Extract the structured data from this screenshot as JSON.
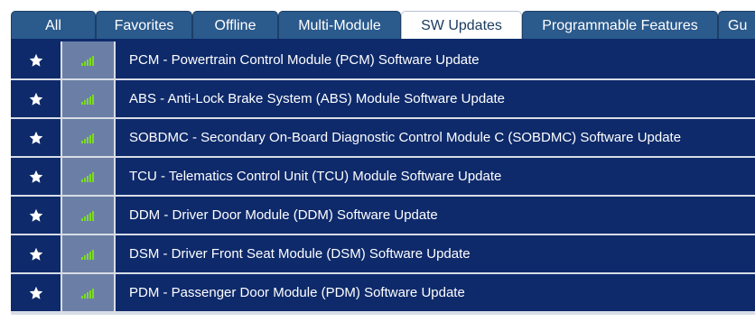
{
  "tabs": [
    {
      "label": "All",
      "active": false
    },
    {
      "label": "Favorites",
      "active": false
    },
    {
      "label": "Offline",
      "active": false
    },
    {
      "label": "Multi-Module",
      "active": false
    },
    {
      "label": "SW Updates",
      "active": true
    },
    {
      "label": "Programmable Features",
      "active": false
    },
    {
      "label": "Gu",
      "active": false
    }
  ],
  "rows": [
    {
      "label": "PCM - Powertrain Control Module (PCM) Software Update",
      "favorite_icon": "star-icon",
      "status_icon": "signal-bars-icon"
    },
    {
      "label": "ABS - Anti-Lock Brake System (ABS) Module Software Update",
      "favorite_icon": "star-icon",
      "status_icon": "signal-bars-icon"
    },
    {
      "label": "SOBDMC - Secondary On-Board Diagnostic Control Module C (SOBDMC) Software Update",
      "favorite_icon": "star-icon",
      "status_icon": "signal-bars-icon"
    },
    {
      "label": "TCU - Telematics Control Unit (TCU) Module Software Update",
      "favorite_icon": "star-icon",
      "status_icon": "signal-bars-icon"
    },
    {
      "label": "DDM - Driver Door Module (DDM) Software Update",
      "favorite_icon": "star-icon",
      "status_icon": "signal-bars-icon"
    },
    {
      "label": "DSM - Driver Front Seat Module (DSM) Software Update",
      "favorite_icon": "star-icon",
      "status_icon": "signal-bars-icon"
    },
    {
      "label": "PDM - Passenger Door Module (PDM) Software Update",
      "favorite_icon": "star-icon",
      "status_icon": "signal-bars-icon"
    }
  ],
  "colors": {
    "row_bg": "#0e2a6b",
    "signal_cell_bg": "#6b7fa6",
    "tab_bg": "#2b5a8c",
    "active_tab_bg": "#ffffff",
    "signal_green": "#7ddc1f"
  }
}
